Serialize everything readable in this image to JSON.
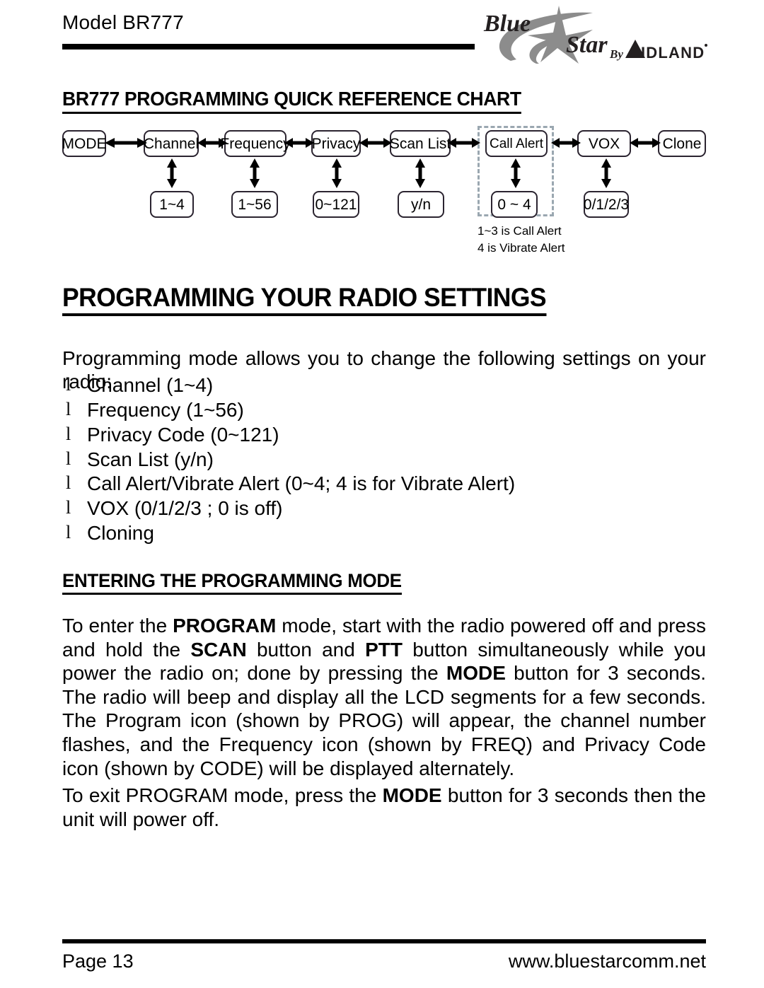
{
  "header": {
    "model_label": "Model BR777",
    "logo": {
      "word_blue": "Blue",
      "word_star": "Star",
      "word_by": "By",
      "word_midland": "MIDLAND",
      "star_color": "#8c8c8c",
      "text_color": "#231f20"
    }
  },
  "chart": {
    "title": "BR777 PROGRAMMING QUICK REFERENCE CHART",
    "selection_color": "#9aa7b0",
    "top_row": [
      {
        "label": "MODE"
      },
      {
        "label": "Channel"
      },
      {
        "label": "Frequency"
      },
      {
        "label": "Privacy"
      },
      {
        "label": "Scan List"
      },
      {
        "label": "Call Alert",
        "selected": true
      },
      {
        "label": "VOX"
      },
      {
        "label": "Clone"
      }
    ],
    "bottom_row": [
      {
        "label": "1~4"
      },
      {
        "label": "1~56"
      },
      {
        "label": "0~121"
      },
      {
        "label": "y/n"
      },
      {
        "label": "0 ~ 4",
        "selected": true
      },
      {
        "label": "0/1/2/3"
      }
    ],
    "note_line1": "1~3 is Call Alert",
    "note_line2": "4 is Vibrate Alert"
  },
  "main": {
    "heading": "PROGRAMMING YOUR RADIO SETTINGS",
    "intro": "Programming mode allows you to change the following settings on your radio:",
    "settings": [
      "Channel (1~4)",
      "Frequency (1~56)",
      "Privacy Code (0~121)",
      "Scan List (y/n)",
      "Call Alert/Vibrate Alert (0~4; 4 is for Vibrate Alert)",
      "VOX (0/1/2/3 ; 0 is off)",
      "Cloning"
    ],
    "bullet_glyph": "l",
    "section_heading": "ENTERING THE PROGRAMMING MODE",
    "para_enter": {
      "s1": "To enter the ",
      "b1": "PROGRAM",
      "s2": " mode, start with the radio powered off and press and hold the ",
      "b2": "SCAN",
      "s3": " button and ",
      "b3": "PTT",
      "s4": " button simultaneously while you power the radio on; done by  pressing the ",
      "b4": "MODE",
      "s5": " button for 3 seconds. The radio will beep and display all the LCD  segments for a few seconds. The Program icon (shown by PROG) will appear, the channel number flashes, and the Frequency icon (shown by FREQ) and Privacy Code icon (shown by CODE) will be displayed alternately."
    },
    "para_exit": {
      "s1": "To exit PROGRAM mode, press the ",
      "b1": "MODE",
      "s2": " button for 3 seconds then the unit will power off."
    }
  },
  "footer": {
    "page": "Page 13",
    "url": "www.bluestarcomm.net"
  }
}
